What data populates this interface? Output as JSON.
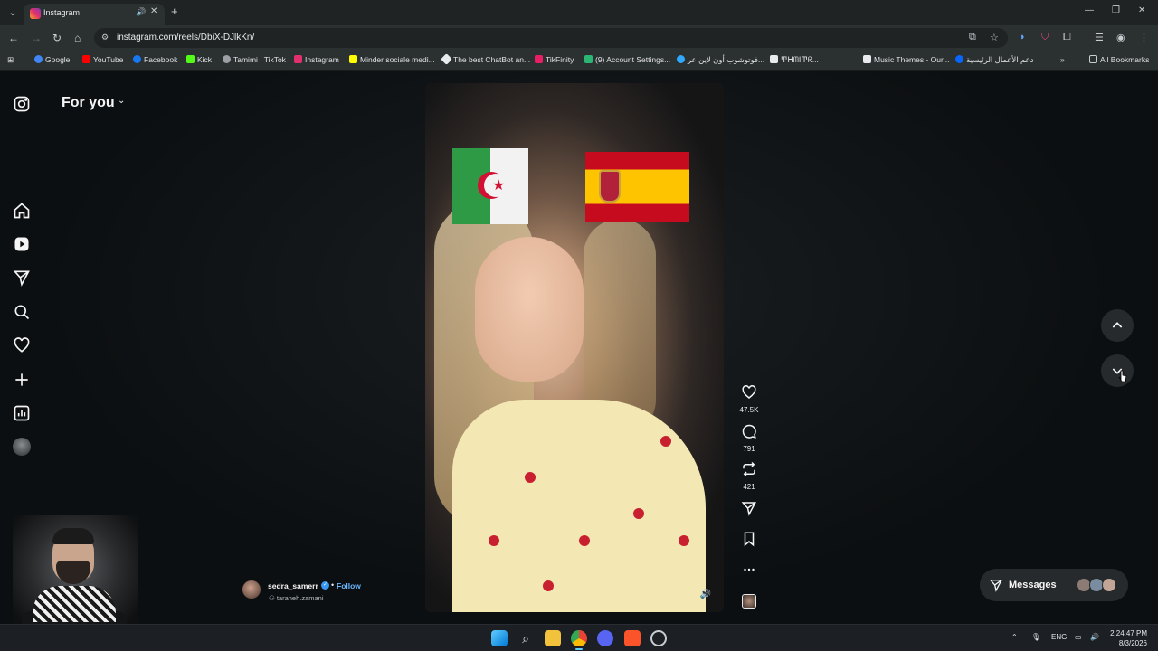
{
  "browser": {
    "tab": {
      "title": "Instagram",
      "favicon": "instagram-icon"
    },
    "url": "instagram.com/reels/DbiX-DJlkKn/",
    "bookmarks": [
      {
        "label": "Google",
        "icon": "google-icon",
        "color": "#4285f4"
      },
      {
        "label": "YouTube",
        "icon": "youtube-icon",
        "color": "#ff0000"
      },
      {
        "label": "Facebook",
        "icon": "facebook-icon",
        "color": "#1877f2"
      },
      {
        "label": "Kick",
        "icon": "kick-icon",
        "color": "#53fc18"
      },
      {
        "label": "Tamimi | TikTok",
        "icon": "globe-icon",
        "color": "#9aa0a6"
      },
      {
        "label": "Instagram",
        "icon": "instagram-icon",
        "color": "#e1306c"
      },
      {
        "label": "Minder sociale medi...",
        "icon": "snapchat-icon",
        "color": "#fffc00"
      },
      {
        "label": "The best ChatBot an...",
        "icon": "chatbot-icon",
        "color": "#e8eaed"
      },
      {
        "label": "TikFinity",
        "icon": "tikfinity-icon",
        "color": "#e91e63"
      },
      {
        "label": "(9) Account Settings...",
        "icon": "settings-site-icon",
        "color": "#2bb673"
      },
      {
        "label": "فوتوشوب أون لاين عر...",
        "icon": "photoshop-icon",
        "color": "#31a8ff"
      },
      {
        "label": "ͲᕼᗰⅠͲᖇ...",
        "icon": "x-icon",
        "color": "#e8eaed"
      },
      {
        "label": "Music Themes - Our...",
        "icon": "music-themes-icon",
        "color": "#e8eaed"
      },
      {
        "label": "دعم الأعمال الرئيسية",
        "icon": "meta-icon",
        "color": "#0866ff"
      }
    ],
    "all_bookmarks": "All Bookmarks"
  },
  "sidebar": {
    "items": [
      {
        "name": "home",
        "icon": "home-icon"
      },
      {
        "name": "reels",
        "icon": "reels-icon"
      },
      {
        "name": "messages",
        "icon": "send-icon"
      },
      {
        "name": "search",
        "icon": "search-icon"
      },
      {
        "name": "notifications",
        "icon": "heart-icon"
      },
      {
        "name": "create",
        "icon": "plus-icon"
      },
      {
        "name": "dashboard",
        "icon": "chart-icon"
      },
      {
        "name": "profile",
        "icon": "avatar-icon"
      }
    ]
  },
  "feed": {
    "title": "For you"
  },
  "reel": {
    "author": "sedra_samerr",
    "follow": "Follow",
    "audio": "taraneh.zamani",
    "likes": "47.5K",
    "comments": "791",
    "reposts": "421"
  },
  "messages_label": "Messages",
  "taskbar": {
    "lang": "ENG",
    "time": "2:24:47 PM",
    "date": "8/3/2026"
  },
  "colors": {
    "accent_link": "#6ab7ff",
    "verified": "#3897f0",
    "background": "#0c0f11"
  }
}
